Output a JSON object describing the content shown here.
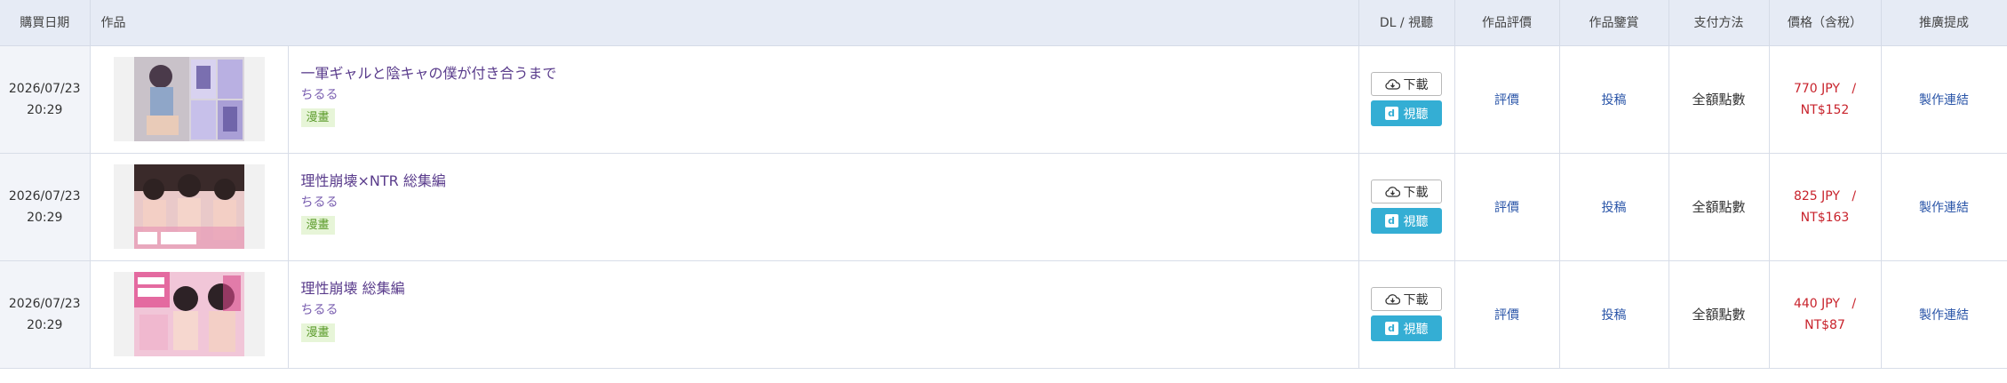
{
  "headers": {
    "date": "購買日期",
    "work": "作品",
    "dl": "DL / 視聽",
    "review": "作品評價",
    "appreciation": "作品鑒賞",
    "payment": "支付方法",
    "price": "價格（含稅）",
    "affiliate": "推廣提成"
  },
  "rows": [
    {
      "date": "2026/07/23",
      "time": "20:29",
      "title": "一軍ギャルと陰キャの僕が付き合うまで",
      "circle": "ちるる",
      "tag": "漫畫",
      "download": "下載",
      "play": "視聽",
      "review": "評價",
      "appreciation": "投稿",
      "payment": "全額點數",
      "price_jpy": "770 JPY",
      "price_sep": "/",
      "price_ntd": "NT$152",
      "affiliate": "製作連結"
    },
    {
      "date": "2026/07/23",
      "time": "20:29",
      "title": "理性崩壊×NTR 総集編",
      "circle": "ちるる",
      "tag": "漫畫",
      "download": "下載",
      "play": "視聽",
      "review": "評價",
      "appreciation": "投稿",
      "payment": "全額點數",
      "price_jpy": "825 JPY",
      "price_sep": "/",
      "price_ntd": "NT$163",
      "affiliate": "製作連結"
    },
    {
      "date": "2026/07/23",
      "time": "20:29",
      "title": "理性崩壊 総集編",
      "circle": "ちるる",
      "tag": "漫畫",
      "download": "下載",
      "play": "視聽",
      "review": "評價",
      "appreciation": "投稿",
      "payment": "全額點數",
      "price_jpy": "440 JPY",
      "price_sep": "/",
      "price_ntd": "NT$87",
      "affiliate": "製作連結"
    }
  ],
  "icons": {
    "download": "cloud-download-icon",
    "play": "play-d-icon"
  },
  "colors": {
    "header_bg": "#e6ebf5",
    "title": "#5a3c8c",
    "tag_bg": "#e7f5d8",
    "tag_text": "#5b9b2a",
    "play_button": "#34aed4",
    "link": "#2a55a8",
    "price": "#c8232c"
  }
}
